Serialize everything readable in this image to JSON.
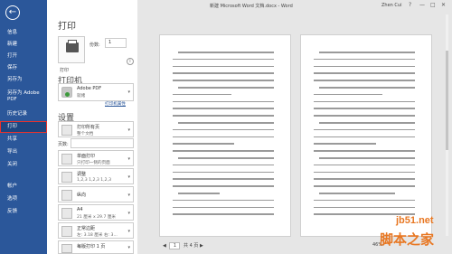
{
  "window": {
    "title": "新建 Microsoft Word 文档.docx - Word",
    "user": "Zhen Cui",
    "controls": [
      "?",
      "—",
      "□",
      "✕"
    ]
  },
  "sidebar": {
    "back_icon": "back-arrow-icon",
    "items": [
      {
        "id": "info",
        "label": "信息"
      },
      {
        "id": "new",
        "label": "新建"
      },
      {
        "id": "open",
        "label": "打开"
      },
      {
        "id": "save",
        "label": "保存"
      },
      {
        "id": "saveas",
        "label": "另存为"
      },
      {
        "id": "saveas-pdf",
        "label": "另存为 Adobe PDF"
      },
      {
        "id": "history",
        "label": "历史记录"
      },
      {
        "id": "print",
        "label": "打印",
        "active": true
      },
      {
        "id": "share",
        "label": "共享"
      },
      {
        "id": "export",
        "label": "导出"
      },
      {
        "id": "close",
        "label": "关闭"
      },
      {
        "id": "account",
        "label": "帐户"
      },
      {
        "id": "options",
        "label": "选项"
      },
      {
        "id": "feedback",
        "label": "反馈"
      }
    ],
    "accent": "#2b579a",
    "highlight": "#e8322d"
  },
  "print": {
    "title": "打印",
    "button_label": "打印",
    "copies_label": "份数:",
    "copies_value": "1",
    "printer_heading": "打印机",
    "printer_name": "Adobe PDF",
    "printer_status": "就绪",
    "printer_properties": "打印机属性",
    "settings_heading": "设置",
    "pages_label": "页数:",
    "pages_value": "",
    "dropdowns": [
      {
        "id": "range",
        "line1": "打印所有页",
        "line2": "整个文档"
      },
      {
        "id": "sides",
        "line1": "单面打印",
        "line2": "只打印一侧的页面"
      },
      {
        "id": "collate",
        "line1": "调整",
        "line2": "1,2,3    1,2,3    1,2,3"
      },
      {
        "id": "orientation",
        "line1": "纵向",
        "line2": ""
      },
      {
        "id": "size",
        "line1": "A4",
        "line2": "21 厘米 x 29.7 厘米"
      },
      {
        "id": "margins",
        "line1": "正常边距",
        "line2": "左: 3.18 厘米  右: 3..."
      },
      {
        "id": "persheet",
        "line1": "每版打印 1 页",
        "line2": ""
      }
    ]
  },
  "preview": {
    "page_current": "1",
    "page_total_text": "共 4 页",
    "zoom": "46%"
  },
  "watermark": {
    "line1": "jb51.net",
    "line2": "脚本之家"
  }
}
